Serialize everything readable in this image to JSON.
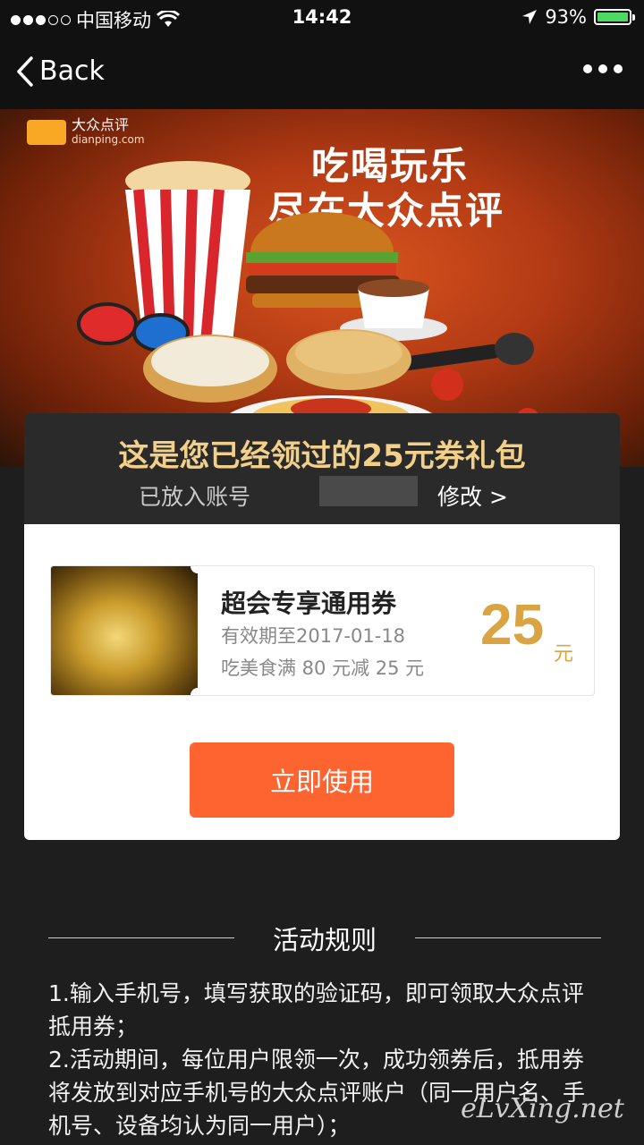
{
  "status_bar": {
    "carrier": "中国移动",
    "time": "14:42",
    "battery_percent": "93%",
    "battery_level": 0.93,
    "signal_bars_filled": 3,
    "signal_bars_total": 5
  },
  "nav": {
    "back_label": "Back"
  },
  "banner": {
    "logo_name": "大众点评",
    "logo_url_text": "dianping.com",
    "slogan_line1": "吃喝玩乐",
    "slogan_line2": "尽在大众点评"
  },
  "card": {
    "title": "这是您已经领过的25元券礼包",
    "account_label": "已放入账号",
    "modify_label": "修改 >",
    "coupon": {
      "name": "超会专享通用券",
      "valid_until": "有效期至2017-01-18",
      "rule": "吃美食满 80 元减 25 元",
      "amount": "25",
      "unit": "元"
    },
    "use_button_label": "立即使用"
  },
  "rules": {
    "title": "活动规则",
    "items": [
      "1.输入手机号，填写获取的验证码，即可领取大众点评抵用券；",
      "2.活动期间，每位用户限领一次，成功领券后，抵用券将发放到对应手机号的大众点评账户（同一用户名、手机号、设备均认为同一用户）；"
    ]
  },
  "watermark": "eLvXing.net",
  "colors": {
    "accent_orange": "#fd6430",
    "gold": "#d9a441",
    "title_gold": "#f2d08a",
    "battery_green": "#4cd964"
  }
}
